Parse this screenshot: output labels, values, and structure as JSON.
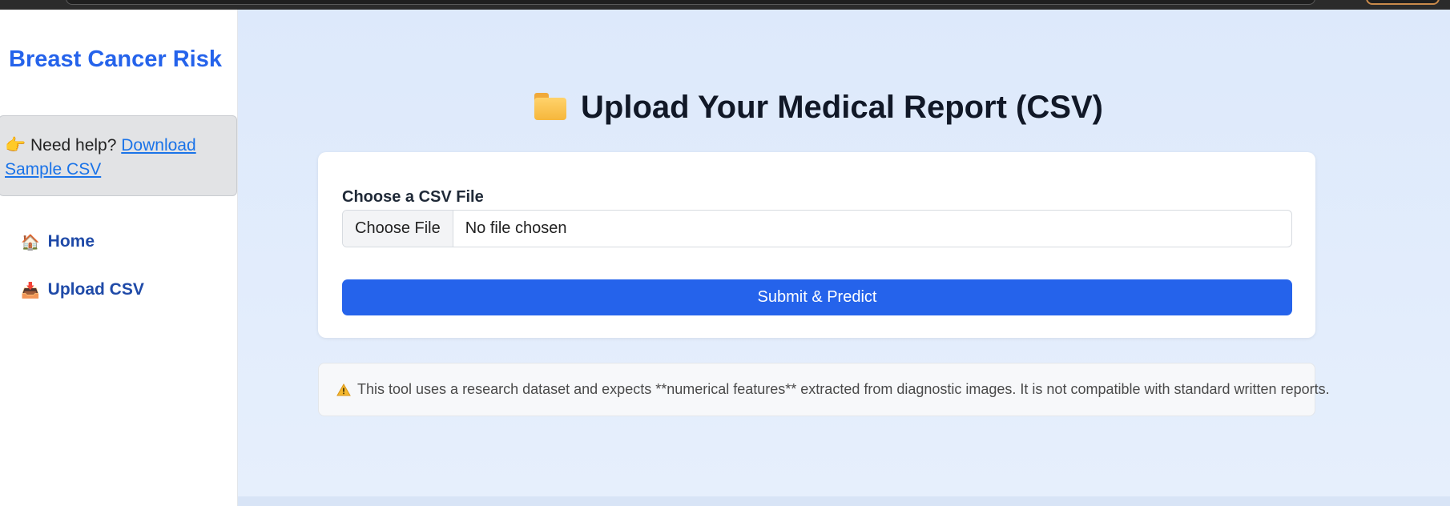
{
  "sidebar": {
    "brand": "Breast Cancer Risk",
    "help": {
      "icon": "pointing-hand-emoji",
      "text": "Need help?",
      "link_label": "Download Sample CSV"
    },
    "nav": [
      {
        "icon": "house-emoji",
        "emoji": "🏠",
        "label": "Home"
      },
      {
        "icon": "inbox-tray-emoji",
        "emoji": "📥",
        "label": "Upload CSV"
      }
    ]
  },
  "main": {
    "title": "Upload Your Medical Report (CSV)",
    "title_icon": "folder-icon",
    "form": {
      "label": "Choose a CSV File",
      "file_button": "Choose File",
      "file_status": "No file chosen",
      "submit_label": "Submit & Predict"
    },
    "notice": {
      "icon": "warning-icon",
      "text": "This tool uses a research dataset and expects **numerical features** extracted from diagnostic images. It is not compatible with standard written reports."
    }
  },
  "colors": {
    "accent": "#2563eb",
    "nav_text": "#1f4aa8",
    "main_bg": "#dde9fb"
  }
}
